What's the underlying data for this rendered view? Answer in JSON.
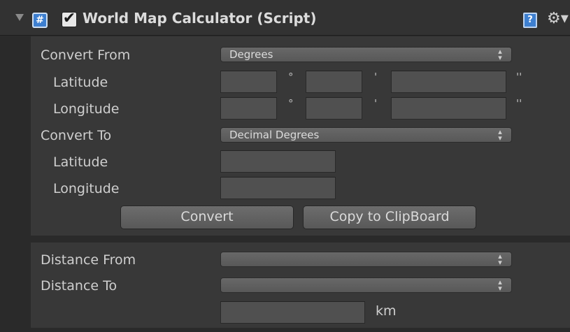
{
  "component": {
    "title": "World Map Calculator (Script)",
    "enabled": true,
    "script_icon_glyph": "#",
    "help_icon_glyph": "?",
    "gear_icon_glyph": "⚙▾",
    "check_glyph": "✔",
    "icons": [
      "foldout-arrow-icon",
      "csharp-script-icon",
      "help-book-icon",
      "gear-icon"
    ]
  },
  "converter": {
    "convert_from_label": "Convert From",
    "convert_from_value": "Degrees",
    "from_latitude_label": "Latitude",
    "from_longitude_label": "Longitude",
    "degree_symbol": "°",
    "minute_symbol": "'",
    "second_symbol": "''",
    "convert_to_label": "Convert To",
    "convert_to_value": "Decimal Degrees",
    "to_latitude_label": "Latitude",
    "to_longitude_label": "Longitude",
    "convert_button": "Convert",
    "copy_button": "Copy to ClipBoard"
  },
  "distance": {
    "from_label": "Distance From",
    "from_value": "",
    "to_label": "Distance To",
    "to_value": "",
    "unit": "km"
  },
  "colors": {
    "panel": "#383838",
    "background": "#2a2a2a",
    "field": "#505050",
    "accent_icon": "#3d7fd0"
  }
}
